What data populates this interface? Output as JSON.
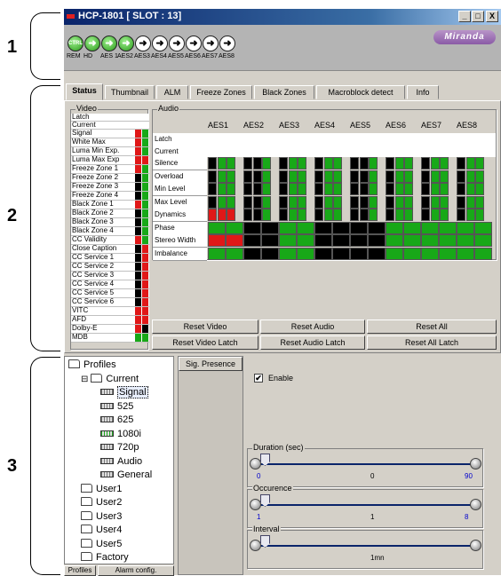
{
  "annotations": [
    "1",
    "2",
    "3"
  ],
  "window": {
    "title": "HCP-1801 [ SLOT : 13]",
    "min": "_",
    "max": "□",
    "close": "X",
    "logo": "Miranda"
  },
  "header": {
    "inputs": [
      {
        "label": "REM",
        "icon": "CTRL",
        "color": "green"
      },
      {
        "label": "HD",
        "color": "green"
      },
      {
        "label": "AES 1",
        "color": "green"
      },
      {
        "label": "AES2",
        "color": "green"
      },
      {
        "label": "AES3",
        "color": "white"
      },
      {
        "label": "AES4",
        "color": "white"
      },
      {
        "label": "AES5",
        "color": "white"
      },
      {
        "label": "AES6",
        "color": "white"
      },
      {
        "label": "AES7",
        "color": "white"
      },
      {
        "label": "AES8",
        "color": "white"
      }
    ]
  },
  "tabs": [
    "Status",
    "Thumbnail",
    "ALM",
    "Freeze Zones",
    "Black Zones",
    "Macroblock detect",
    "Info"
  ],
  "status": {
    "video_legend": "Video",
    "video_latch": "Latch",
    "video_current": "Current",
    "video_rows": [
      [
        "Signal",
        "r",
        "g"
      ],
      [
        "White Max",
        "r",
        "g"
      ],
      [
        "Luma Min Exp.",
        "r",
        "g"
      ],
      [
        "Luma Max Exp",
        "r",
        "r"
      ],
      [
        "Freeze Zone 1",
        "r",
        "g"
      ],
      [
        "Freeze Zone 2",
        "k",
        "g"
      ],
      [
        "Freeze Zone 3",
        "k",
        "g"
      ],
      [
        "Freeze Zone 4",
        "k",
        "g"
      ],
      [
        "Black Zone 1",
        "r",
        "g"
      ],
      [
        "Black Zone 2",
        "k",
        "g"
      ],
      [
        "Black Zone 3",
        "k",
        "g"
      ],
      [
        "Black Zone 4",
        "k",
        "g"
      ],
      [
        "CC Validity",
        "r",
        "g"
      ],
      [
        "Close Caption",
        "k",
        "r"
      ],
      [
        "CC Service 1",
        "k",
        "r"
      ],
      [
        "CC Service 2",
        "k",
        "r"
      ],
      [
        "CC Service 3",
        "k",
        "r"
      ],
      [
        "CC Service 4",
        "k",
        "r"
      ],
      [
        "CC Service 5",
        "k",
        "r"
      ],
      [
        "CC Service 6",
        "k",
        "r"
      ],
      [
        "VITC",
        "r",
        "r"
      ],
      [
        "AFD",
        "r",
        "r"
      ],
      [
        "Dolby-E",
        "r",
        "k"
      ],
      [
        "MDB",
        "g",
        "g"
      ]
    ],
    "audio_legend": "Audio",
    "aes_headers": [
      "AES1",
      "AES2",
      "AES3",
      "AES4",
      "AES5",
      "AES6",
      "AES7",
      "AES8"
    ],
    "audio_latch": "Latch",
    "audio_current": "Current",
    "audio_rows": [
      [
        "Silence",
        "kgg",
        "kkg",
        "kgg",
        "kgg",
        "kkg",
        "kgg",
        "kgg",
        "kgg"
      ],
      [
        "Overload",
        "kgg",
        "kkg",
        "kgg",
        "kgg",
        "kkg",
        "kgg",
        "kgg",
        "kgg"
      ],
      [
        "Min Level",
        "kgg",
        "kkg",
        "kgg",
        "kgg",
        "kkg",
        "kgg",
        "kgg",
        "kgg"
      ],
      [
        "Max Level",
        "kgg",
        "kkg",
        "kgg",
        "kgg",
        "kkg",
        "kgg",
        "kgg",
        "kgg"
      ],
      [
        "Dynamics",
        "rrr",
        "kkg",
        "kgg",
        "kgg",
        "kkg",
        "kgg",
        "kgg",
        "kgg"
      ],
      [
        "Phase",
        "gg",
        "kk",
        "gg",
        "kk",
        "kk",
        "gg",
        "gg",
        "gg"
      ],
      [
        "Stereo Width",
        "rr",
        "kk",
        "gg",
        "kk",
        "kk",
        "gg",
        "gg",
        "gg"
      ],
      [
        "Imbalance",
        "gg",
        "kk",
        "gg",
        "kk",
        "kk",
        "gg",
        "gg",
        "gg"
      ]
    ],
    "buttons": [
      "Reset Video",
      "Reset Audio",
      "Reset All",
      "Reset Video Latch",
      "Reset Audio Latch",
      "Reset All Latch"
    ]
  },
  "tree": {
    "items": [
      {
        "t": "Profiles",
        "lvl": 0,
        "k": "folder"
      },
      {
        "t": "Current",
        "lvl": 1,
        "k": "folder",
        "exp": "⊟"
      },
      {
        "t": "Signal",
        "lvl": 2,
        "k": "card",
        "sel": true
      },
      {
        "t": "525",
        "lvl": 2,
        "k": "card"
      },
      {
        "t": "625",
        "lvl": 2,
        "k": "card"
      },
      {
        "t": "1080i",
        "lvl": 2,
        "k": "cardg"
      },
      {
        "t": "720p",
        "lvl": 2,
        "k": "card"
      },
      {
        "t": "Audio",
        "lvl": 2,
        "k": "card"
      },
      {
        "t": "General",
        "lvl": 2,
        "k": "card"
      },
      {
        "t": "User1",
        "lvl": 1,
        "k": "folder"
      },
      {
        "t": "User2",
        "lvl": 1,
        "k": "folder"
      },
      {
        "t": "User3",
        "lvl": 1,
        "k": "folder"
      },
      {
        "t": "User4",
        "lvl": 1,
        "k": "folder"
      },
      {
        "t": "User5",
        "lvl": 1,
        "k": "folder"
      },
      {
        "t": "Factory",
        "lvl": 1,
        "k": "folder"
      }
    ],
    "tabs": [
      "Profiles",
      "Alarm config."
    ]
  },
  "alarm": {
    "list_item": "Sig. Presence",
    "enable": "Enable",
    "checked": true,
    "sliders": [
      {
        "legend": "Duration (sec)",
        "min": "0",
        "value": "0",
        "max": "90",
        "fraction": 0.0
      },
      {
        "legend": "Occurence",
        "min": "1",
        "value": "1",
        "max": "8",
        "fraction": 0.0
      },
      {
        "legend": "Interval",
        "min": "",
        "value": "1mn",
        "max": "",
        "fraction": 0.0
      }
    ]
  },
  "colors": {
    "r": "#e01818",
    "g": "#18a818",
    "k": "#000000"
  }
}
